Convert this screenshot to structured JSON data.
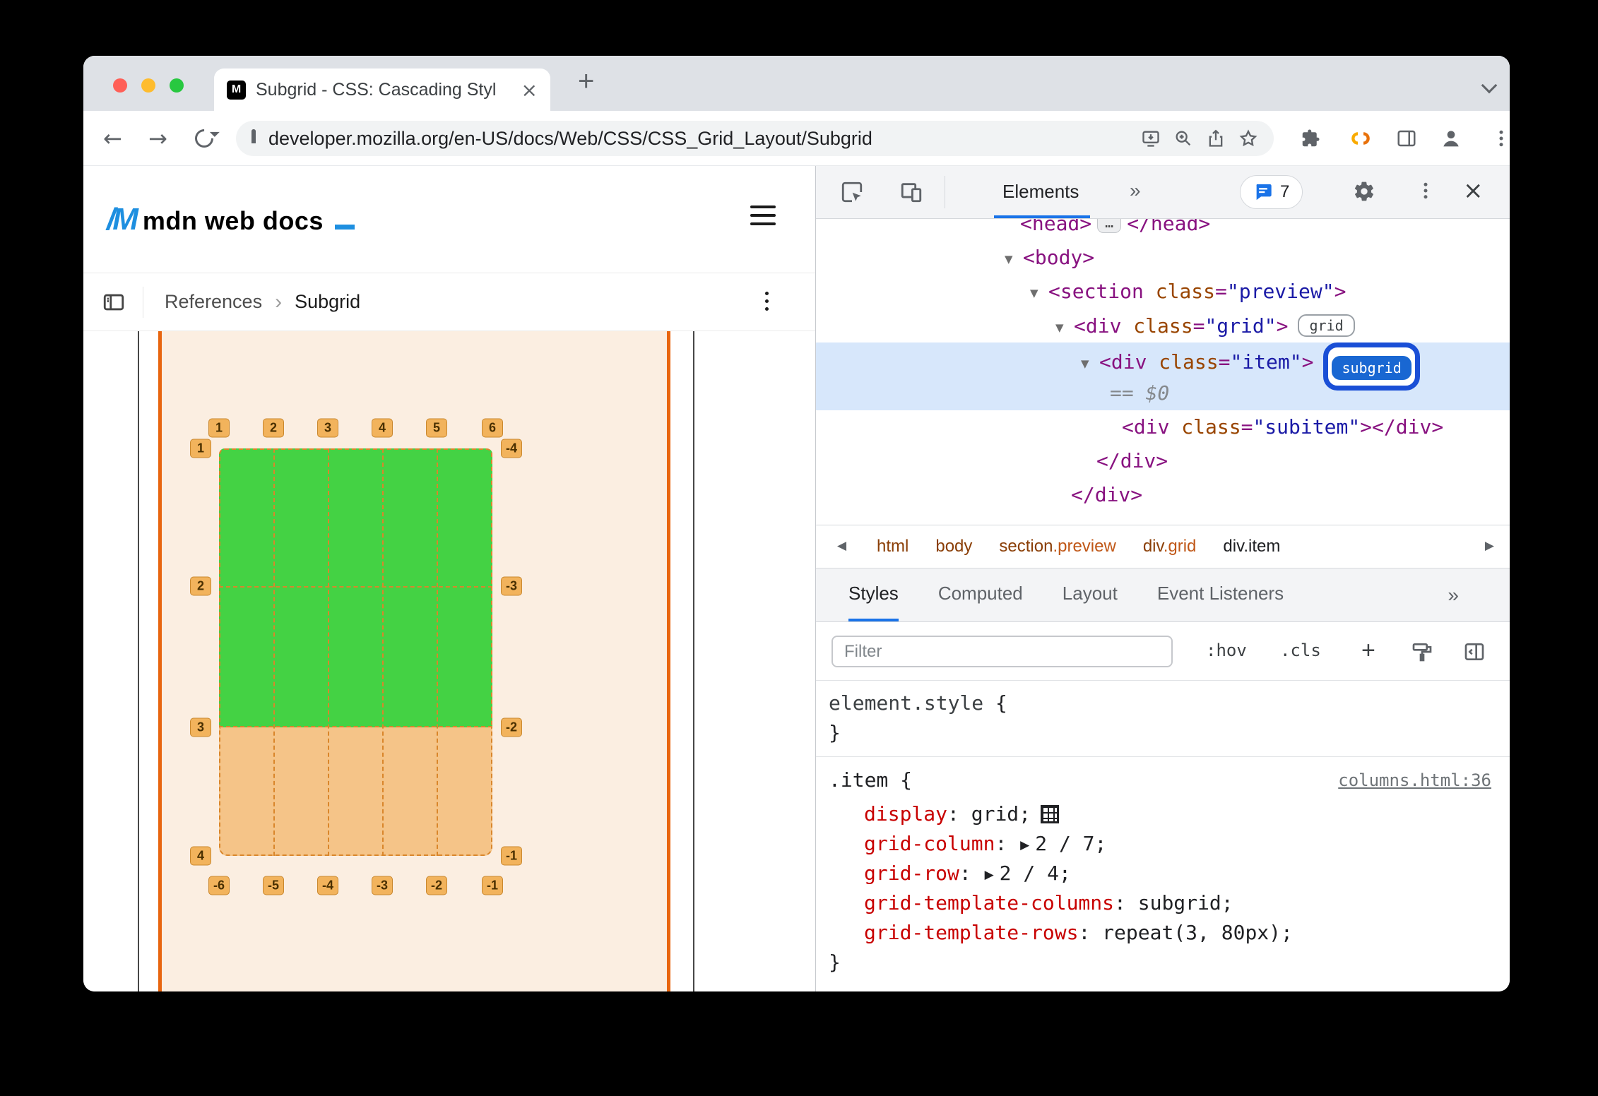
{
  "colors": {
    "accent_blue": "#1A73E8",
    "badge_blue": "#1967D2",
    "grid_green": "#44D244",
    "item_tan": "#F5C488",
    "frame_orange": "#E8650F",
    "label_orange": "#F2B35C"
  },
  "browser": {
    "tab_title": "Subgrid - CSS: Cascading Styl",
    "tab_close": "×",
    "new_tab": "+",
    "favicon_letter": "M",
    "back": "←",
    "forward": "→",
    "url": "developer.mozilla.org/en-US/docs/Web/CSS/CSS_Grid_Layout/Subgrid"
  },
  "mdn": {
    "logo_mark": "/M",
    "logo_text": "mdn web docs",
    "breadcrumb_parent": "References",
    "breadcrumb_sep": "›",
    "breadcrumb_current": "Subgrid",
    "figure": {
      "top_labels": [
        "1",
        "2",
        "3",
        "4",
        "5",
        "6"
      ],
      "left_labels": [
        "1",
        "2",
        "3",
        "4"
      ],
      "right_labels": [
        "-4",
        "-3",
        "-2",
        "-1"
      ],
      "bottom_labels": [
        "-6",
        "-5",
        "-4",
        "-3",
        "-2",
        "-1"
      ]
    }
  },
  "devtools": {
    "toolbar": {
      "elements_tab": "Elements",
      "more_tabs": "»",
      "messages_count": "7",
      "close": "×"
    },
    "dom_lines": [
      {
        "pad": 289,
        "clip": true,
        "tokens": [
          {
            "t": "tag",
            "v": "<head>"
          },
          {
            "t": "ellipsis",
            "v": "…"
          },
          {
            "t": "tag",
            "v": "</head>"
          }
        ]
      },
      {
        "pad": 267,
        "tokens": [
          {
            "t": "arrow",
            "v": "▼"
          },
          {
            "t": "tag",
            "v": "<body>"
          }
        ]
      },
      {
        "pad": 303,
        "tokens": [
          {
            "t": "arrow",
            "v": "▼"
          },
          {
            "t": "tag",
            "v": "<section "
          },
          {
            "t": "attr",
            "v": "class"
          },
          {
            "t": "punct",
            "v": "="
          },
          {
            "t": "val",
            "v": "\"preview\""
          },
          {
            "t": "tag",
            "v": ">"
          }
        ]
      },
      {
        "pad": 339,
        "tokens": [
          {
            "t": "arrow",
            "v": "▼"
          },
          {
            "t": "tag",
            "v": "<div "
          },
          {
            "t": "attr",
            "v": "class"
          },
          {
            "t": "punct",
            "v": "="
          },
          {
            "t": "val",
            "v": "\"grid\""
          },
          {
            "t": "tag",
            "v": ">"
          },
          {
            "t": "badge",
            "v": "grid"
          }
        ]
      },
      {
        "pad": 375,
        "selected": true,
        "tokens": [
          {
            "t": "arrow",
            "v": "▼"
          },
          {
            "t": "tag",
            "v": "<div "
          },
          {
            "t": "attr",
            "v": "class"
          },
          {
            "t": "punct",
            "v": "="
          },
          {
            "t": "val",
            "v": "\"item\""
          },
          {
            "t": "tag",
            "v": ">"
          },
          {
            "t": "badgeActive",
            "v": "subgrid"
          }
        ]
      },
      {
        "pad": 416,
        "selected": true,
        "tokens": [
          {
            "t": "meta",
            "v": "== $0"
          }
        ]
      },
      {
        "pad": 433,
        "tokens": [
          {
            "t": "tag",
            "v": "<div "
          },
          {
            "t": "attr",
            "v": "class"
          },
          {
            "t": "punct",
            "v": "="
          },
          {
            "t": "val",
            "v": "\"subitem\""
          },
          {
            "t": "tag",
            "v": ">"
          },
          {
            "t": "tag",
            "v": "</div>"
          }
        ]
      },
      {
        "pad": 397,
        "tokens": [
          {
            "t": "tag",
            "v": "</div>"
          }
        ]
      },
      {
        "pad": 361,
        "tokens": [
          {
            "t": "tag",
            "v": "</div>"
          }
        ]
      }
    ],
    "crumbs": [
      {
        "tag": "html",
        "cls": ""
      },
      {
        "tag": "body",
        "cls": ""
      },
      {
        "tag": "section",
        "cls": ".preview"
      },
      {
        "tag": "div",
        "cls": ".grid"
      },
      {
        "tag": "div",
        "cls": ".item",
        "selected": true
      }
    ],
    "panel_tabs": [
      {
        "label": "Styles",
        "active": true
      },
      {
        "label": "Computed",
        "active": false
      },
      {
        "label": "Layout",
        "active": false
      },
      {
        "label": "Event Listeners",
        "active": false
      }
    ],
    "panel_more": "»",
    "filter": {
      "placeholder": "Filter",
      "hov": ":hov",
      "cls": ".cls",
      "plus": "+"
    },
    "styles": {
      "element_style": "element.style",
      "open_brace": "{",
      "close_brace": "}",
      "rule": {
        "selector": ".item",
        "source": "columns.html:36",
        "props": [
          {
            "name": "display",
            "value": "grid",
            "icon": true
          },
          {
            "name": "grid-column",
            "value": "2 / 7",
            "arrow": true
          },
          {
            "name": "grid-row",
            "value": "2 / 4",
            "arrow": true
          },
          {
            "name": "grid-template-columns",
            "value": "subgrid"
          },
          {
            "name": "grid-template-rows",
            "value": "repeat(3, 80px)"
          }
        ]
      }
    }
  }
}
